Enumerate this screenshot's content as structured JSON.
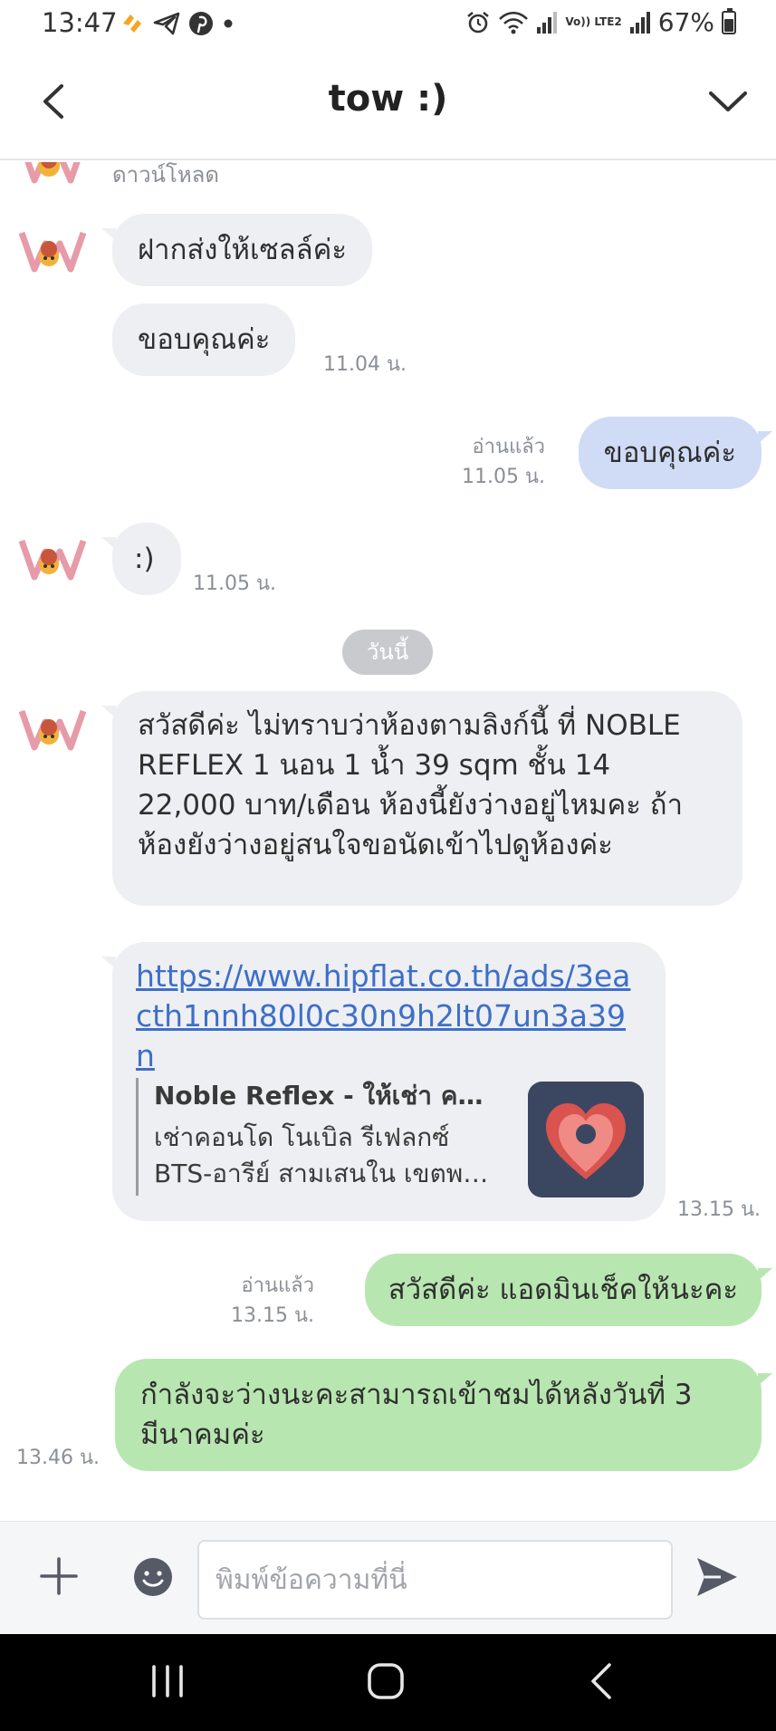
{
  "status_bar": {
    "time": "13:47",
    "battery": "67%",
    "network": "Vo)) LTE2"
  },
  "header": {
    "title": "tow :)"
  },
  "chat": {
    "clipped_label": "ดาวน์โหลด",
    "messages": [
      {
        "text": "ฝากส่งให้เซลล์ค่ะ"
      },
      {
        "text": "ขอบคุณค่ะ",
        "time": "11.04 น."
      },
      {
        "text": "ขอบคุณค่ะ",
        "read": "อ่านแล้ว",
        "time": "11.05 น."
      },
      {
        "text": ":)",
        "time": "11.05 น."
      },
      {
        "text": "สวัสดีค่ะ ไม่ทราบว่าห้องตามลิงก์นี้ ที่ NOBLE REFLEX 1 นอน 1 น้ำ 39 sqm ชั้น 14 22,000 บาท/เดือน ห้องนี้ยังว่างอยู่ไหมคะ ถ้าห้องยังว่างอยู่สนใจขอนัดเข้าไปดูห้องค่ะ"
      },
      {
        "link": "https://www.hipflat.co.th/ads/3eacth1nnh80l0c30n9h2lt07un3a39n",
        "preview_title": "Noble Reflex - ให้เช่า คอนโด",
        "preview_desc_line1": "เช่าคอนโด โนเบิล รีเฟลกซ์",
        "preview_desc_line2": "BTS-อารีย์ สามเสนใน เขตพญาไท",
        "time": "13.15 น."
      },
      {
        "text": "สวัสดีค่ะ แอดมินเช็คให้นะคะ",
        "read": "อ่านแล้ว",
        "time": "13.15 น."
      },
      {
        "text": "กำลังจะว่างนะคะสามารถเข้าชมได้หลังวันที่ 3 มีนาคมค่ะ",
        "time": "13.46 น."
      }
    ],
    "date_separator": "วันนี้"
  },
  "input": {
    "placeholder": "พิมพ์ข้อความที่นี่"
  },
  "colors": {
    "incoming_bubble": "#eeeff2",
    "outgoing_bubble": "#b8e6b0",
    "outgoing_bubble_read_earlier": "#d0dcf6",
    "link": "#3d6fc9"
  }
}
